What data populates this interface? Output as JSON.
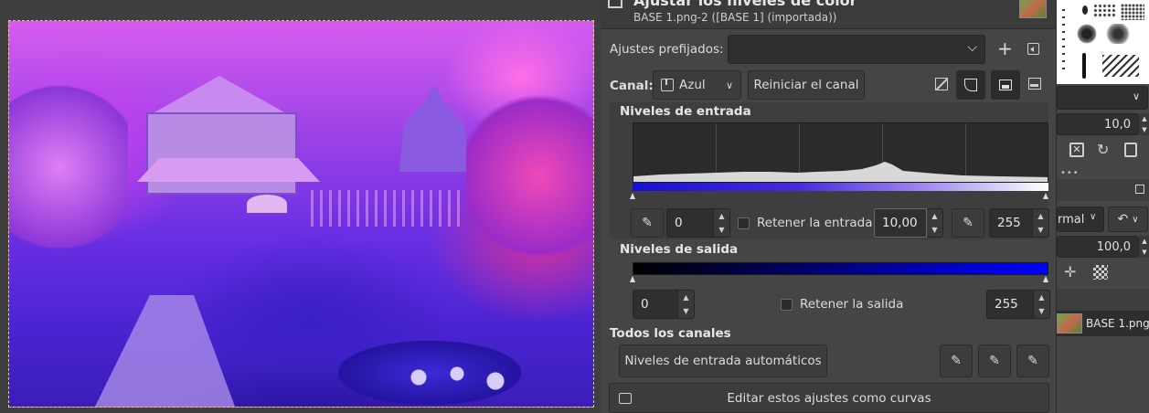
{
  "dialog": {
    "title": "Ajustar los niveles de color",
    "subtitle": "BASE 1.png-2 ([BASE 1] (importada))"
  },
  "presets": {
    "label": "Ajustes prefijados:",
    "value": ""
  },
  "channel": {
    "label": "Canal:",
    "value": "Azul",
    "reset_label": "Reiniciar el canal"
  },
  "input_levels": {
    "heading": "Niveles de entrada",
    "low": "0",
    "gamma": "10,00",
    "high": "255",
    "keep_label": "Retener la entrada"
  },
  "output_levels": {
    "heading": "Niveles de salida",
    "low": "0",
    "high": "255",
    "keep_label": "Retener la salida"
  },
  "all_channels": {
    "heading": "Todos los canales",
    "auto_label": "Niveles de entrada automáticos"
  },
  "edit_curves_label": "Editar estos ajustes como curvas",
  "right_panel": {
    "size_value": "10,0",
    "mode_value": "rmal",
    "opacity_value": "100,0",
    "layer_name": "BASE 1.png"
  },
  "colors": {
    "histogram_bg": "#2b2b2b",
    "channel_blue": "#0000ff",
    "accent_selection": "#e8d84a"
  }
}
